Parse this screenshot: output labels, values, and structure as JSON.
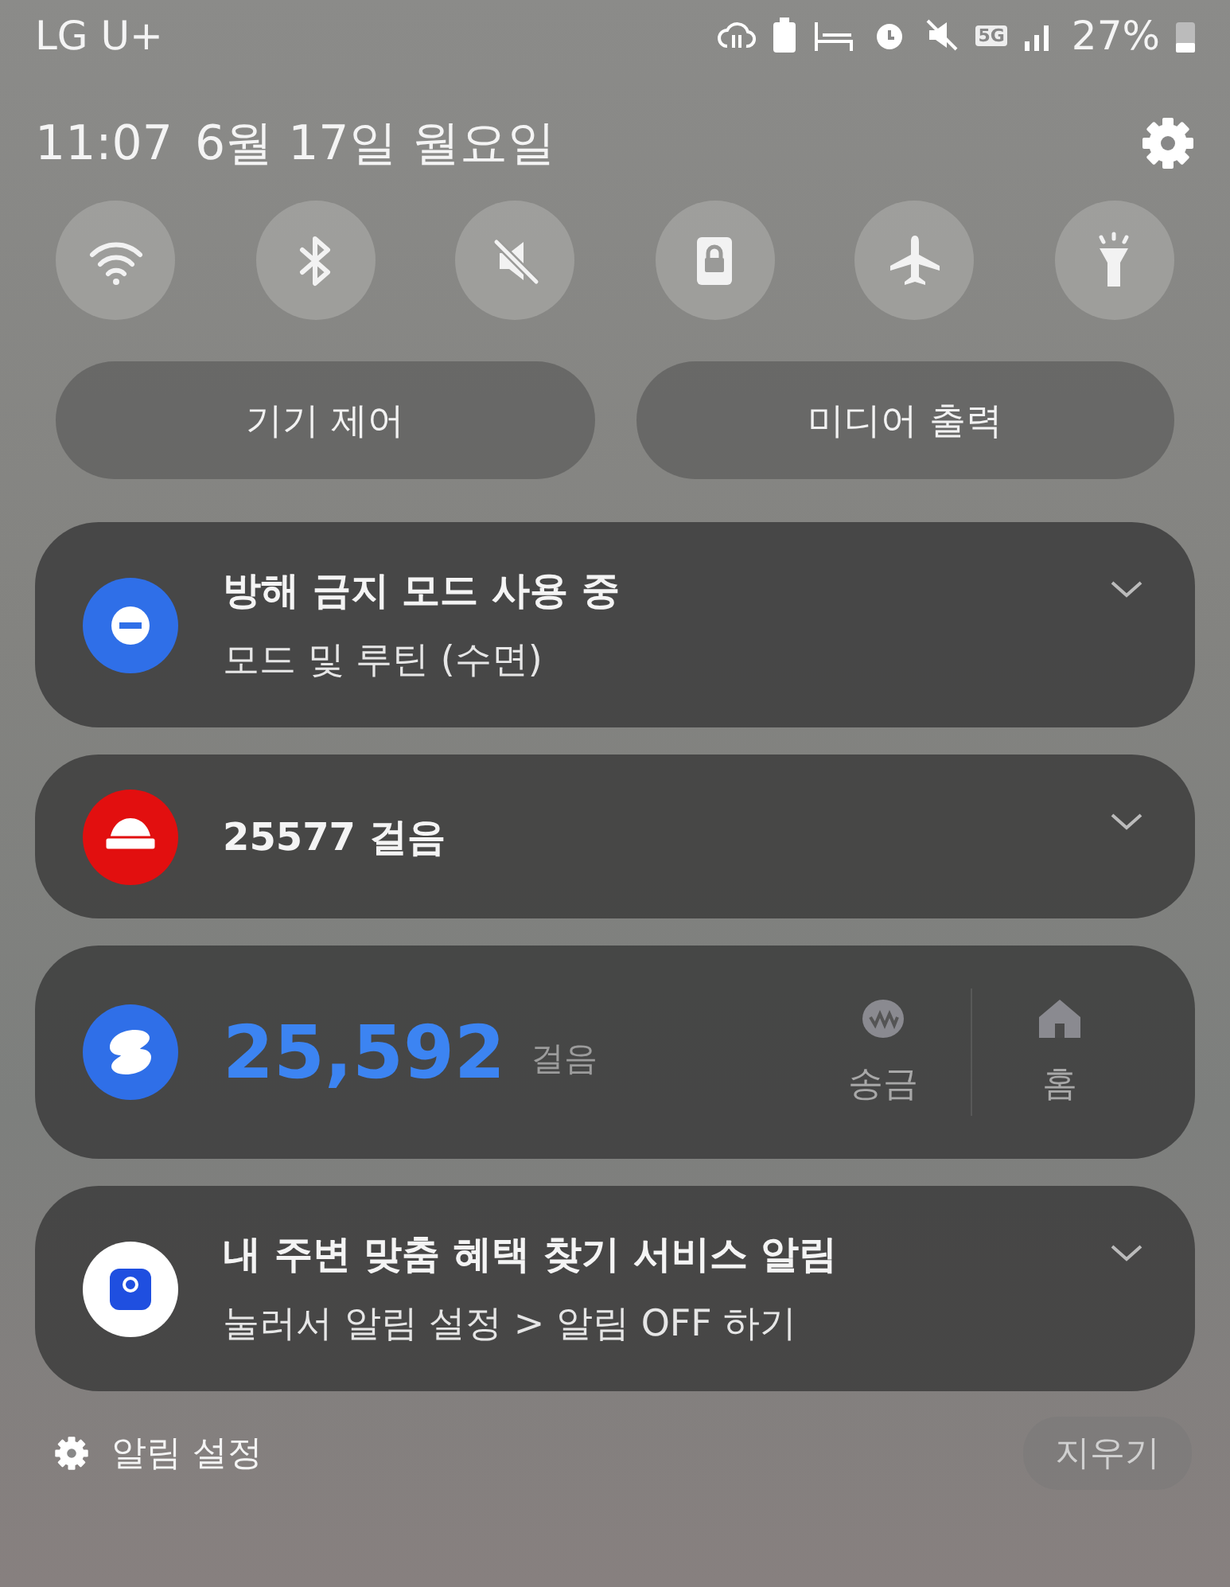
{
  "status_bar": {
    "carrier": "LG U+",
    "network": "5G",
    "battery": "27%"
  },
  "header": {
    "time": "11:07",
    "date": "6월 17일 월요일"
  },
  "quick_toggles": [
    {
      "kind": "wifi",
      "on": false
    },
    {
      "kind": "bluetooth",
      "on": false
    },
    {
      "kind": "mute",
      "on": false
    },
    {
      "kind": "lock",
      "on": false
    },
    {
      "kind": "airplane",
      "on": false
    },
    {
      "kind": "flashlight",
      "on": false
    }
  ],
  "buttons": [
    "기기 제어",
    "미디어 출력"
  ],
  "notifications": [
    {
      "kind": "dnd",
      "title": "방해 금지 모드 사용 중",
      "subtitle": "모드 및 루틴 (수면)"
    },
    {
      "kind": "steps",
      "title": "25577 걸음"
    },
    {
      "kind": "toss",
      "value": "25,592",
      "unit": "걸음",
      "actions": [
        {
          "kind": "transfer",
          "label": "송금"
        },
        {
          "kind": "home",
          "label": "홈"
        }
      ]
    },
    {
      "kind": "pay",
      "title": "내 주변 맞춤 혜택 찾기 서비스 알림",
      "subtitle": "눌러서 알림 설정 > 알림 OFF 하기"
    }
  ],
  "footer": {
    "settings_label": "알림 설정",
    "clear_button": {
      "label": "지우기",
      "disabled": true
    }
  }
}
